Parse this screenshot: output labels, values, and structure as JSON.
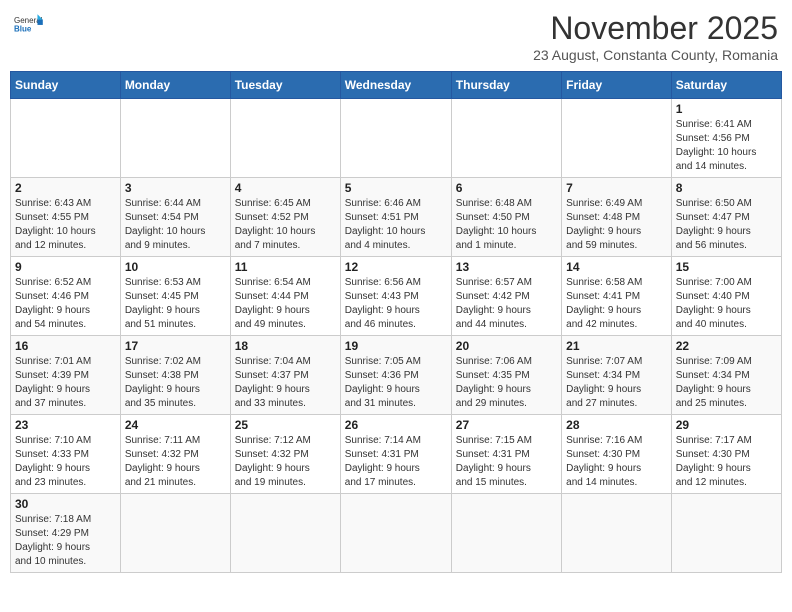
{
  "logo": {
    "text_general": "General",
    "text_blue": "Blue"
  },
  "title": "November 2025",
  "subtitle": "23 August, Constanta County, Romania",
  "days": [
    "Sunday",
    "Monday",
    "Tuesday",
    "Wednesday",
    "Thursday",
    "Friday",
    "Saturday"
  ],
  "weeks": [
    [
      {
        "day": "",
        "info": ""
      },
      {
        "day": "",
        "info": ""
      },
      {
        "day": "",
        "info": ""
      },
      {
        "day": "",
        "info": ""
      },
      {
        "day": "",
        "info": ""
      },
      {
        "day": "",
        "info": ""
      },
      {
        "day": "1",
        "info": "Sunrise: 6:41 AM\nSunset: 4:56 PM\nDaylight: 10 hours\nand 14 minutes."
      }
    ],
    [
      {
        "day": "2",
        "info": "Sunrise: 6:43 AM\nSunset: 4:55 PM\nDaylight: 10 hours\nand 12 minutes."
      },
      {
        "day": "3",
        "info": "Sunrise: 6:44 AM\nSunset: 4:54 PM\nDaylight: 10 hours\nand 9 minutes."
      },
      {
        "day": "4",
        "info": "Sunrise: 6:45 AM\nSunset: 4:52 PM\nDaylight: 10 hours\nand 7 minutes."
      },
      {
        "day": "5",
        "info": "Sunrise: 6:46 AM\nSunset: 4:51 PM\nDaylight: 10 hours\nand 4 minutes."
      },
      {
        "day": "6",
        "info": "Sunrise: 6:48 AM\nSunset: 4:50 PM\nDaylight: 10 hours\nand 1 minute."
      },
      {
        "day": "7",
        "info": "Sunrise: 6:49 AM\nSunset: 4:48 PM\nDaylight: 9 hours\nand 59 minutes."
      },
      {
        "day": "8",
        "info": "Sunrise: 6:50 AM\nSunset: 4:47 PM\nDaylight: 9 hours\nand 56 minutes."
      }
    ],
    [
      {
        "day": "9",
        "info": "Sunrise: 6:52 AM\nSunset: 4:46 PM\nDaylight: 9 hours\nand 54 minutes."
      },
      {
        "day": "10",
        "info": "Sunrise: 6:53 AM\nSunset: 4:45 PM\nDaylight: 9 hours\nand 51 minutes."
      },
      {
        "day": "11",
        "info": "Sunrise: 6:54 AM\nSunset: 4:44 PM\nDaylight: 9 hours\nand 49 minutes."
      },
      {
        "day": "12",
        "info": "Sunrise: 6:56 AM\nSunset: 4:43 PM\nDaylight: 9 hours\nand 46 minutes."
      },
      {
        "day": "13",
        "info": "Sunrise: 6:57 AM\nSunset: 4:42 PM\nDaylight: 9 hours\nand 44 minutes."
      },
      {
        "day": "14",
        "info": "Sunrise: 6:58 AM\nSunset: 4:41 PM\nDaylight: 9 hours\nand 42 minutes."
      },
      {
        "day": "15",
        "info": "Sunrise: 7:00 AM\nSunset: 4:40 PM\nDaylight: 9 hours\nand 40 minutes."
      }
    ],
    [
      {
        "day": "16",
        "info": "Sunrise: 7:01 AM\nSunset: 4:39 PM\nDaylight: 9 hours\nand 37 minutes."
      },
      {
        "day": "17",
        "info": "Sunrise: 7:02 AM\nSunset: 4:38 PM\nDaylight: 9 hours\nand 35 minutes."
      },
      {
        "day": "18",
        "info": "Sunrise: 7:04 AM\nSunset: 4:37 PM\nDaylight: 9 hours\nand 33 minutes."
      },
      {
        "day": "19",
        "info": "Sunrise: 7:05 AM\nSunset: 4:36 PM\nDaylight: 9 hours\nand 31 minutes."
      },
      {
        "day": "20",
        "info": "Sunrise: 7:06 AM\nSunset: 4:35 PM\nDaylight: 9 hours\nand 29 minutes."
      },
      {
        "day": "21",
        "info": "Sunrise: 7:07 AM\nSunset: 4:34 PM\nDaylight: 9 hours\nand 27 minutes."
      },
      {
        "day": "22",
        "info": "Sunrise: 7:09 AM\nSunset: 4:34 PM\nDaylight: 9 hours\nand 25 minutes."
      }
    ],
    [
      {
        "day": "23",
        "info": "Sunrise: 7:10 AM\nSunset: 4:33 PM\nDaylight: 9 hours\nand 23 minutes."
      },
      {
        "day": "24",
        "info": "Sunrise: 7:11 AM\nSunset: 4:32 PM\nDaylight: 9 hours\nand 21 minutes."
      },
      {
        "day": "25",
        "info": "Sunrise: 7:12 AM\nSunset: 4:32 PM\nDaylight: 9 hours\nand 19 minutes."
      },
      {
        "day": "26",
        "info": "Sunrise: 7:14 AM\nSunset: 4:31 PM\nDaylight: 9 hours\nand 17 minutes."
      },
      {
        "day": "27",
        "info": "Sunrise: 7:15 AM\nSunset: 4:31 PM\nDaylight: 9 hours\nand 15 minutes."
      },
      {
        "day": "28",
        "info": "Sunrise: 7:16 AM\nSunset: 4:30 PM\nDaylight: 9 hours\nand 14 minutes."
      },
      {
        "day": "29",
        "info": "Sunrise: 7:17 AM\nSunset: 4:30 PM\nDaylight: 9 hours\nand 12 minutes."
      }
    ],
    [
      {
        "day": "30",
        "info": "Sunrise: 7:18 AM\nSunset: 4:29 PM\nDaylight: 9 hours\nand 10 minutes."
      },
      {
        "day": "",
        "info": ""
      },
      {
        "day": "",
        "info": ""
      },
      {
        "day": "",
        "info": ""
      },
      {
        "day": "",
        "info": ""
      },
      {
        "day": "",
        "info": ""
      },
      {
        "day": "",
        "info": ""
      }
    ]
  ]
}
